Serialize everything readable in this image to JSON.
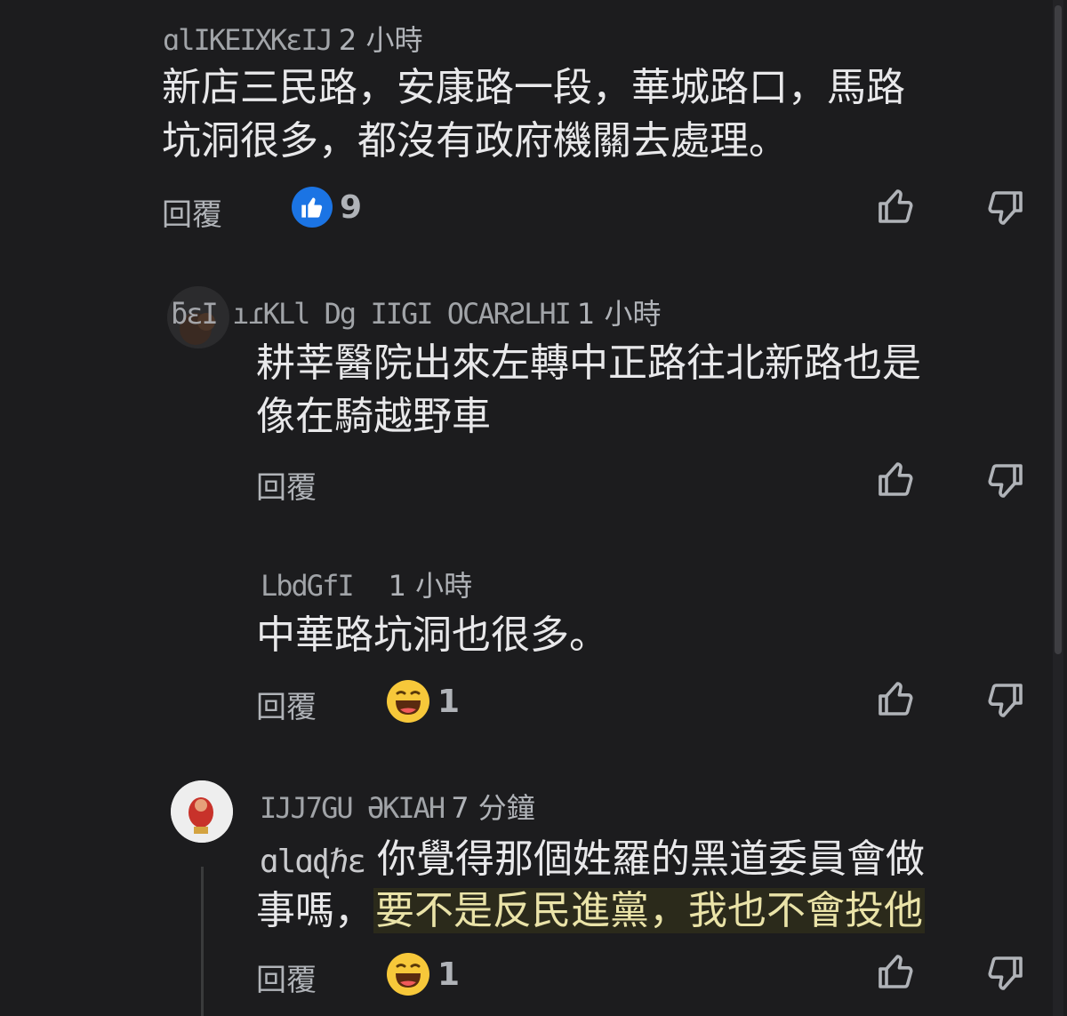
{
  "comments": [
    {
      "name": "ɑlIKEIXKɛIJ",
      "time": "2 小時",
      "text_line1": "新店三民路，安康路一段，華城路口，馬路",
      "text_line2": "坑洞很多，都沒有政府機關去處理。",
      "reply_label": "回覆",
      "reaction_icon": "like-reaction-icon",
      "reaction_count": "9"
    },
    {
      "name": "ƃɛI ıɾKLl Dg IIGI OCARƧLHI",
      "time": "1 小時",
      "text_line1": "耕莘醫院出來左轉中正路往北新路也是",
      "text_line2": "像在騎越野車",
      "reply_label": "回覆"
    },
    {
      "name": "LbdGfI",
      "time": "1 小時",
      "text_line1": "中華路坑洞也很多。",
      "reply_label": "回覆",
      "reaction_icon": "haha-reaction-icon",
      "reaction_count": "1"
    },
    {
      "name": "IJJ7GU ƏKIAH",
      "time": "7 分鐘",
      "mention": "ɑlɑɖℏɛ",
      "text_line1": "你覺得那個姓羅的黑道委員會做",
      "text_line2_plain": "事嗎，",
      "text_line2_highlight": "要不是反民進黨，我也不會投他",
      "reply_label": "回覆",
      "reaction_icon": "haha-reaction-icon",
      "reaction_count": "1"
    }
  ],
  "colors": {
    "background": "#1c1c1e",
    "text_primary": "#e8e8ea",
    "text_secondary": "#b0b3b8",
    "like_blue": "#1b74e4",
    "highlight_bg": "#2b2a1b"
  }
}
